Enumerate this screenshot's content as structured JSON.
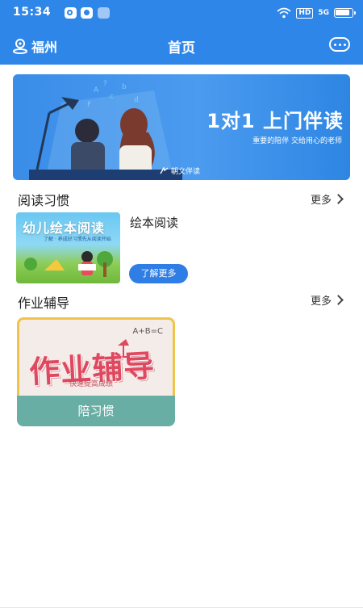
{
  "status_bar": {
    "time": "15:34",
    "hd": "HD",
    "signal": "5G"
  },
  "header": {
    "location": "福州",
    "title": "首页"
  },
  "banner": {
    "headline": "1对1  上门伴读",
    "subline": "重要的陪伴  交给用心的老师",
    "brand": "朝文伴读"
  },
  "sections": {
    "reading": {
      "title": "阅读习惯",
      "more": "更多",
      "thumb_title": "幼儿绘本阅读",
      "thumb_small": "了解 · 养成好习惯先从阅读开始",
      "item_name": "绘本阅读",
      "cta": "了解更多"
    },
    "homework": {
      "title": "作业辅导",
      "more": "更多",
      "thumb_big": "作业辅导",
      "thumb_tagline": "快速提高成绩",
      "thumb_formula": "A+B=C",
      "label": "陪习惯"
    }
  },
  "colors": {
    "primary": "#2f86e9",
    "button": "#2f7ee6",
    "card_label": "#69aea4",
    "card_border": "#f0c34b",
    "card_text": "#e0485f"
  }
}
